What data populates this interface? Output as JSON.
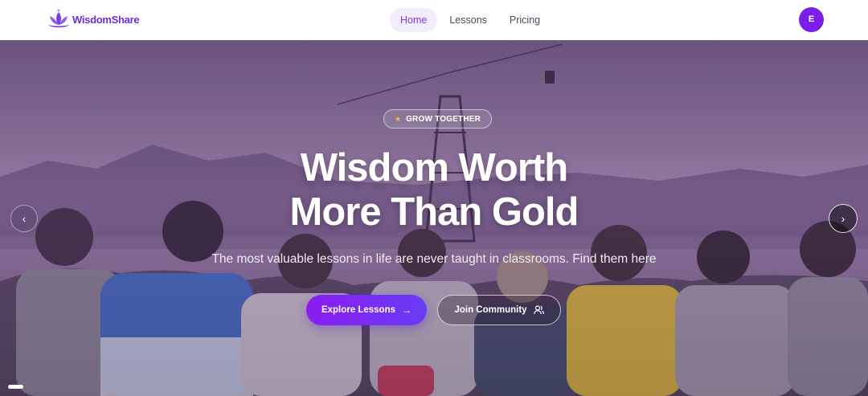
{
  "header": {
    "logo_text": "WisdomShare",
    "nav": [
      {
        "label": "Home",
        "active": true
      },
      {
        "label": "Lessons",
        "active": false
      },
      {
        "label": "Pricing",
        "active": false
      }
    ],
    "avatar_initial": "E"
  },
  "hero": {
    "badge": {
      "icon": "star-icon",
      "text": "GROW TOGETHER"
    },
    "title_line1": "Wisdom Worth",
    "title_line2": "More Than Gold",
    "subtitle": "The most valuable lessons in life are never taught in classrooms. Find them here",
    "primary_button": {
      "label": "Explore Lessons",
      "icon": "arrow-right-icon"
    },
    "secondary_button": {
      "label": "Join Community",
      "icon": "users-icon"
    },
    "prev_icon": "chevron-left-icon",
    "next_icon": "chevron-right-icon"
  },
  "colors": {
    "brand": "#7c3aed",
    "avatar": "#7b1fe6",
    "button_gradient_start": "#8b1cf0",
    "button_gradient_end": "#6a3cf5",
    "star": "#f6c244"
  }
}
